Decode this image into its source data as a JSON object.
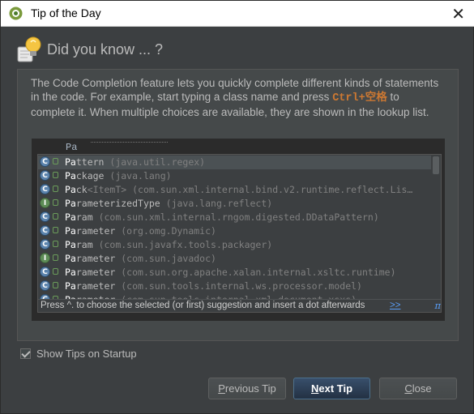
{
  "window": {
    "title": "Tip of the Day",
    "close_glyph": "✕"
  },
  "header": {
    "icon": "lightbulb-icon",
    "text": "Did you know ... ?"
  },
  "tip": {
    "text_before": "The Code Completion feature lets you quickly complete different kinds of statements in the code. For example, start typing a class name and press ",
    "shortcut": "Ctrl+空格",
    "text_after": " to complete it. When multiple choices are available, they are shown in the lookup list.",
    "typed": "Pa"
  },
  "lookup": {
    "items": [
      {
        "prefix": "Pa",
        "rest": "ttern",
        "type": "",
        "pkg": " (java.util.regex)",
        "icon": "class-icon",
        "selected": true
      },
      {
        "prefix": "Pa",
        "rest": "ckage",
        "type": "",
        "pkg": " (java.lang)",
        "icon": "class-icon",
        "selected": false
      },
      {
        "prefix": "Pa",
        "rest": "ck",
        "type": "<ItemT>",
        "pkg": " (com.sun.xml.internal.bind.v2.runtime.reflect.Lis…",
        "icon": "class-icon",
        "selected": false
      },
      {
        "prefix": "Pa",
        "rest": "rameterizedType",
        "type": "",
        "pkg": " (java.lang.reflect)",
        "icon": "interface-icon",
        "selected": false
      },
      {
        "prefix": "Pa",
        "rest": "ram",
        "type": "",
        "pkg": " (com.sun.xml.internal.rngom.digested.DDataPattern)",
        "icon": "class-icon",
        "selected": false
      },
      {
        "prefix": "Pa",
        "rest": "rameter",
        "type": "",
        "pkg": " (org.omg.Dynamic)",
        "icon": "class-icon",
        "selected": false
      },
      {
        "prefix": "Pa",
        "rest": "ram",
        "type": "",
        "pkg": " (com.sun.javafx.tools.packager)",
        "icon": "class-icon",
        "selected": false
      },
      {
        "prefix": "Pa",
        "rest": "rameter",
        "type": "",
        "pkg": " (com.sun.javadoc)",
        "icon": "interface-icon",
        "selected": false
      },
      {
        "prefix": "Pa",
        "rest": "rameter",
        "type": "",
        "pkg": " (com.sun.org.apache.xalan.internal.xsltc.runtime)",
        "icon": "class-icon",
        "selected": false
      },
      {
        "prefix": "Pa",
        "rest": "rameter",
        "type": "",
        "pkg": " (com.sun.tools.internal.ws.processor.model)",
        "icon": "class-icon",
        "selected": false
      },
      {
        "prefix": "Pa",
        "rest": "rameter",
        "type": "",
        "pkg": " (com.sun.tools.internal.xml.document.xsxs)",
        "icon": "class-icon",
        "selected": false
      }
    ],
    "footer_text": "Press ^. to choose the selected (or first) suggestion and insert a dot afterwards",
    "footer_link": ">>",
    "footer_pi": "π"
  },
  "options": {
    "show_tips_label": "Show Tips on Startup",
    "show_tips_checked": true
  },
  "buttons": {
    "previous": {
      "pre": "",
      "mnemonic": "P",
      "post": "revious Tip"
    },
    "next": {
      "pre": "",
      "mnemonic": "N",
      "post": "ext Tip"
    },
    "close": {
      "pre": "",
      "mnemonic": "C",
      "post": "lose"
    }
  },
  "colors": {
    "background": "#3c3f41",
    "shortcut": "#cc7832",
    "link": "#589df6",
    "primary_button": "#365880"
  }
}
